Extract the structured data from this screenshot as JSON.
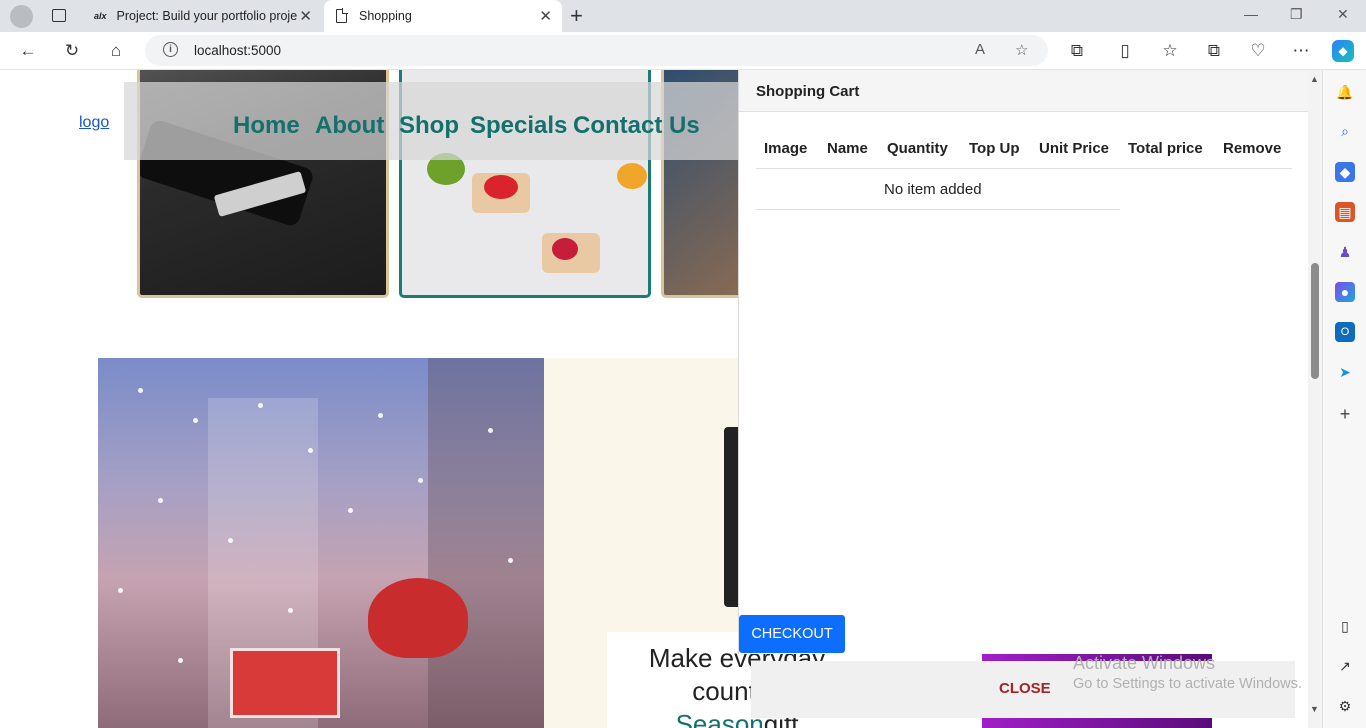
{
  "browser": {
    "tabs": [
      {
        "label": "Project: Build your portfolio proje",
        "favicon": "alx"
      },
      {
        "label": "Shopping"
      }
    ],
    "new_tab": "+",
    "url": "localhost:5000",
    "window_controls": {
      "minimize": "—",
      "restore": "❐",
      "close": "✕"
    }
  },
  "nav": {
    "logo_alt": "logo",
    "items": [
      "Home",
      "About",
      "Shop",
      "Specials",
      "Contact Us"
    ]
  },
  "promo": {
    "line1": "Make everyday",
    "line2": "count w",
    "line3a": "Season",
    "line3b": "gift"
  },
  "cart": {
    "title": "Shopping Cart",
    "columns": [
      "Image",
      "Name",
      "Quantity",
      "Top Up",
      "Unit Price",
      "Total price",
      "Remove"
    ],
    "empty_message": "No item added",
    "checkout_label": "CHECKOUT",
    "close_label": "CLOSE"
  },
  "watermark": {
    "line1": "Activate Windows",
    "line2": "Go to Settings to activate Windows."
  }
}
